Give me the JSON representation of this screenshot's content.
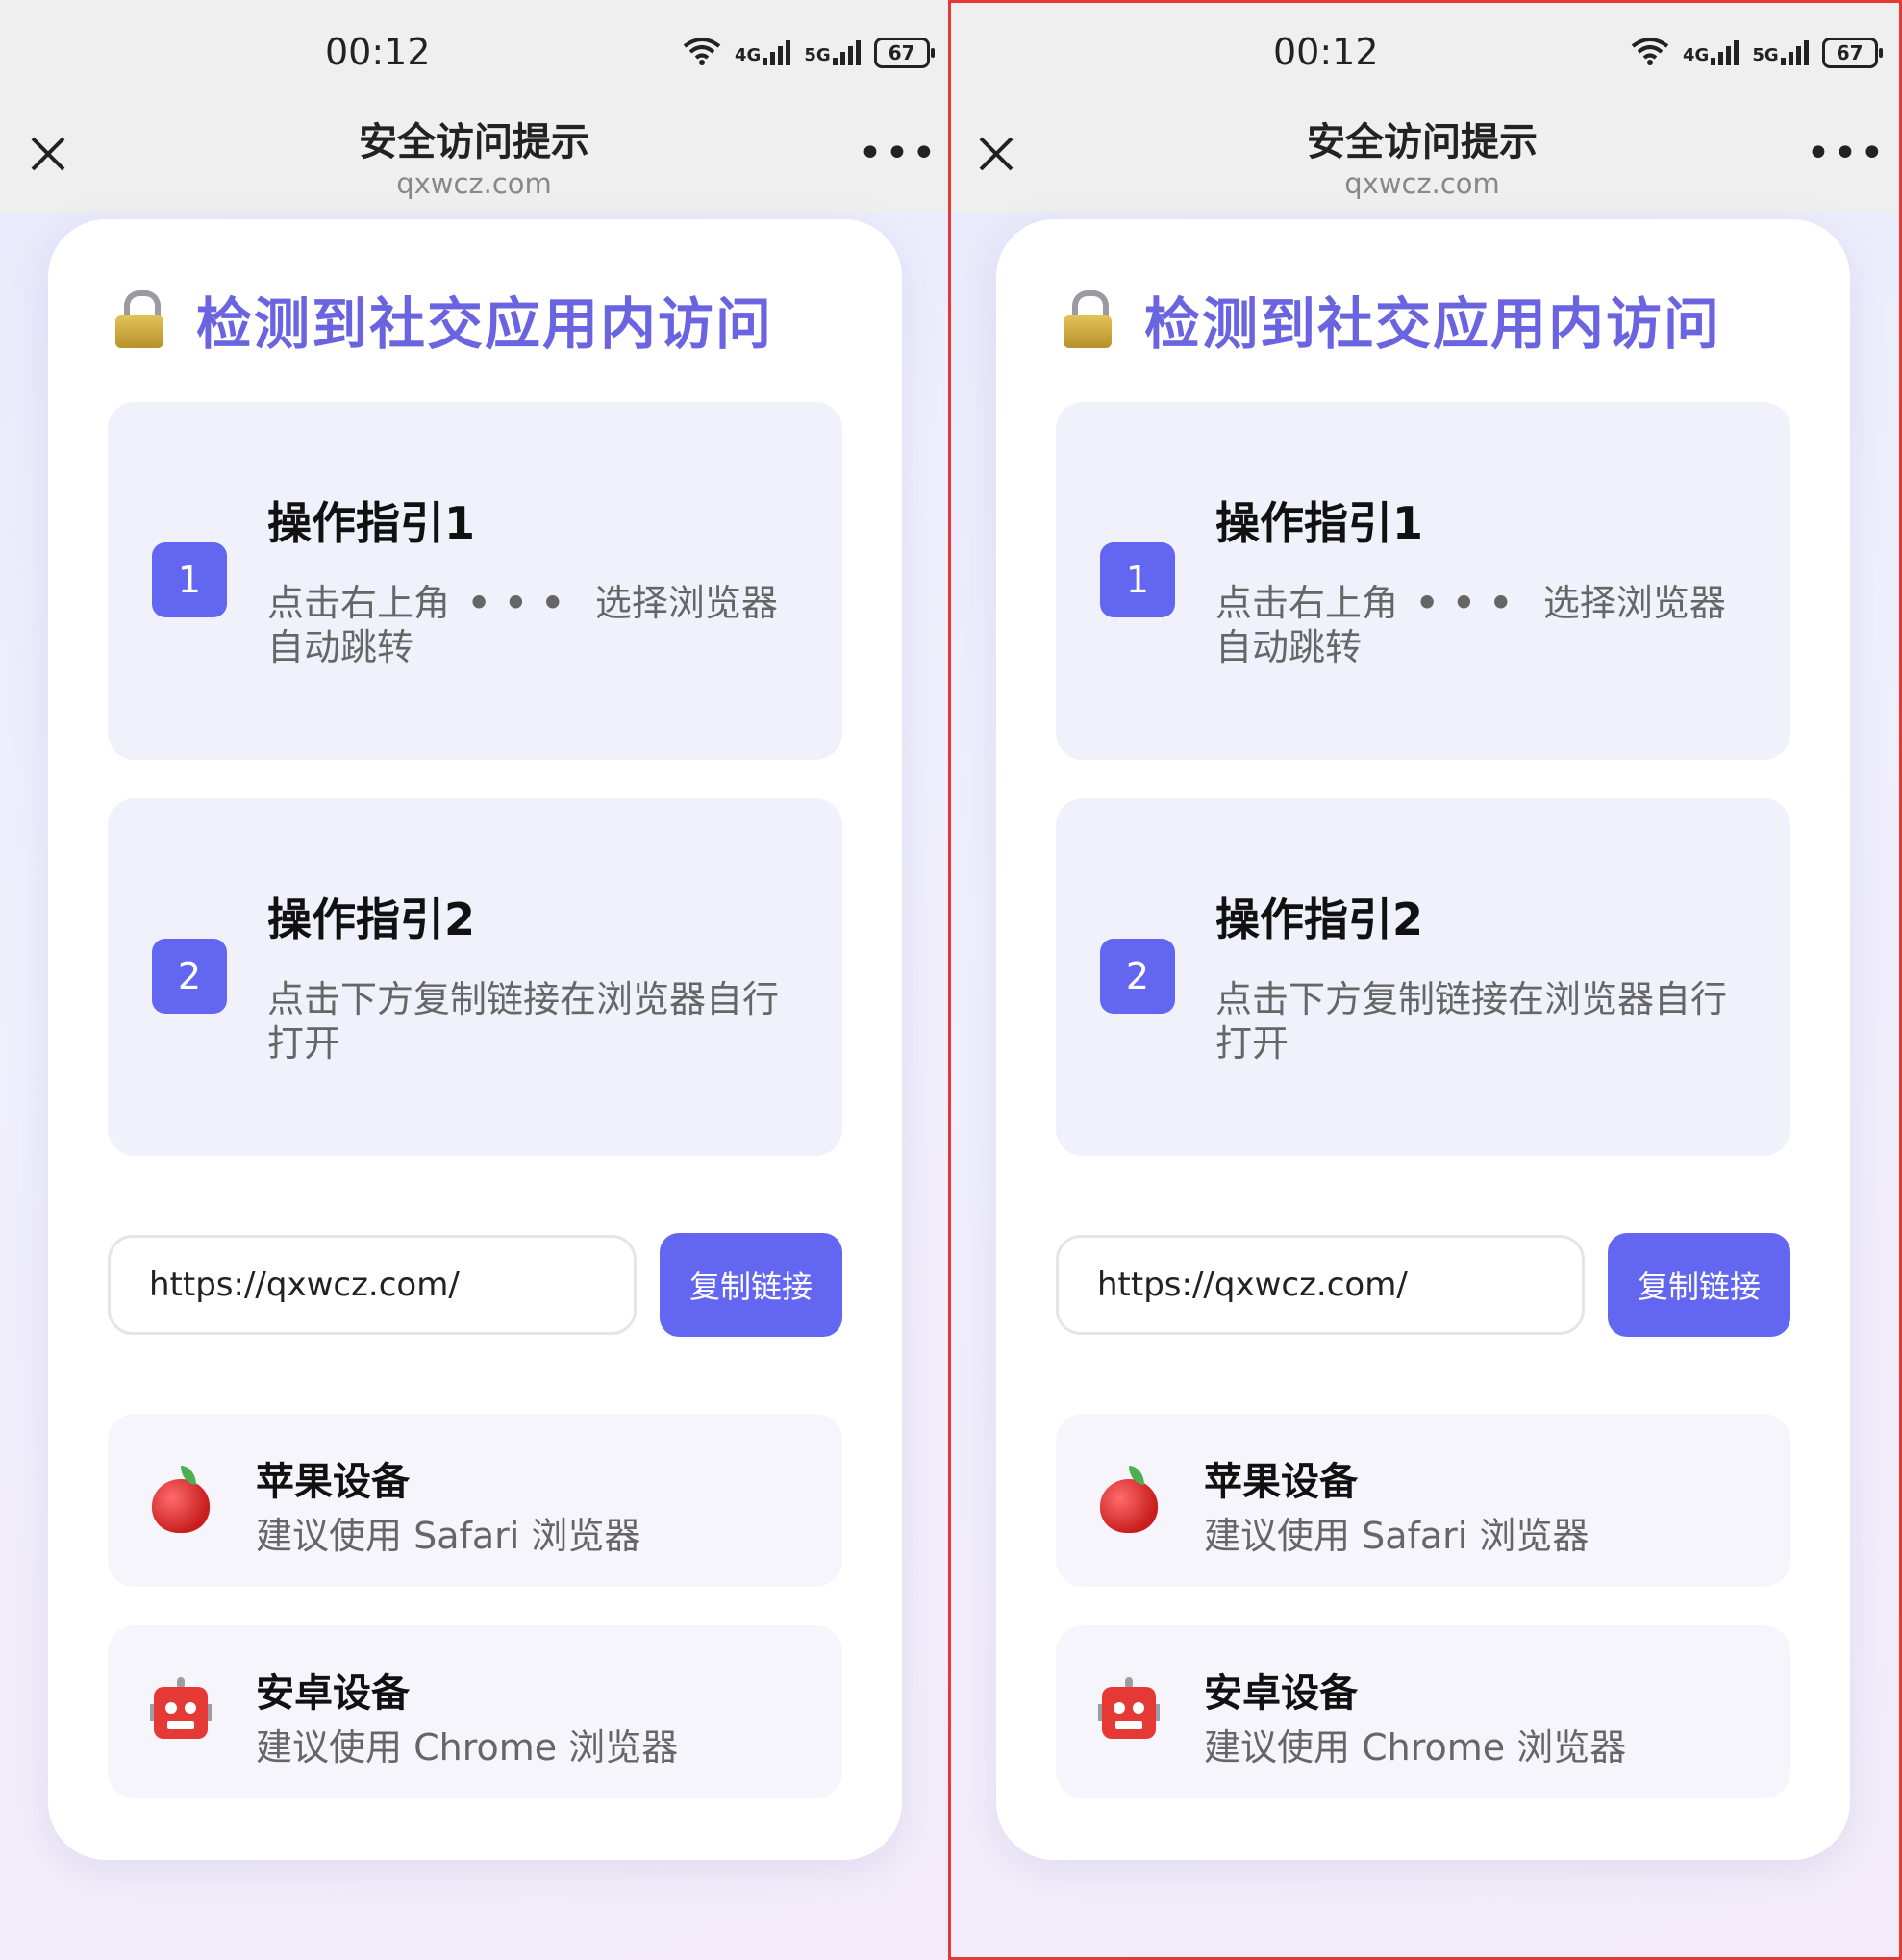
{
  "status_bar": {
    "time": "00:12",
    "network1": "4G",
    "network2": "5G",
    "battery": "67"
  },
  "nav": {
    "title": "安全访问提示",
    "domain": "qxwcz.com",
    "more": "•••"
  },
  "card": {
    "heading": "检测到社交应用内访问",
    "steps": [
      {
        "number": "1",
        "title": "操作指引1",
        "desc_before": "点击右上角",
        "dots": "•••",
        "desc_after": "选择浏览器自动跳转"
      },
      {
        "number": "2",
        "title": "操作指引2",
        "desc": "点击下方复制链接在浏览器自行打开"
      }
    ],
    "url_value": "https://qxwcz.com/",
    "copy_button": "复制链接",
    "devices": [
      {
        "icon": "apple-icon",
        "title": "苹果设备",
        "desc": "建议使用 Safari 浏览器"
      },
      {
        "icon": "robot-icon",
        "title": "安卓设备",
        "desc": "建议使用 Chrome 浏览器"
      }
    ]
  },
  "colors": {
    "accent": "#6366f1",
    "heading": "#6a64e0",
    "highlight_border": "#e53935"
  }
}
